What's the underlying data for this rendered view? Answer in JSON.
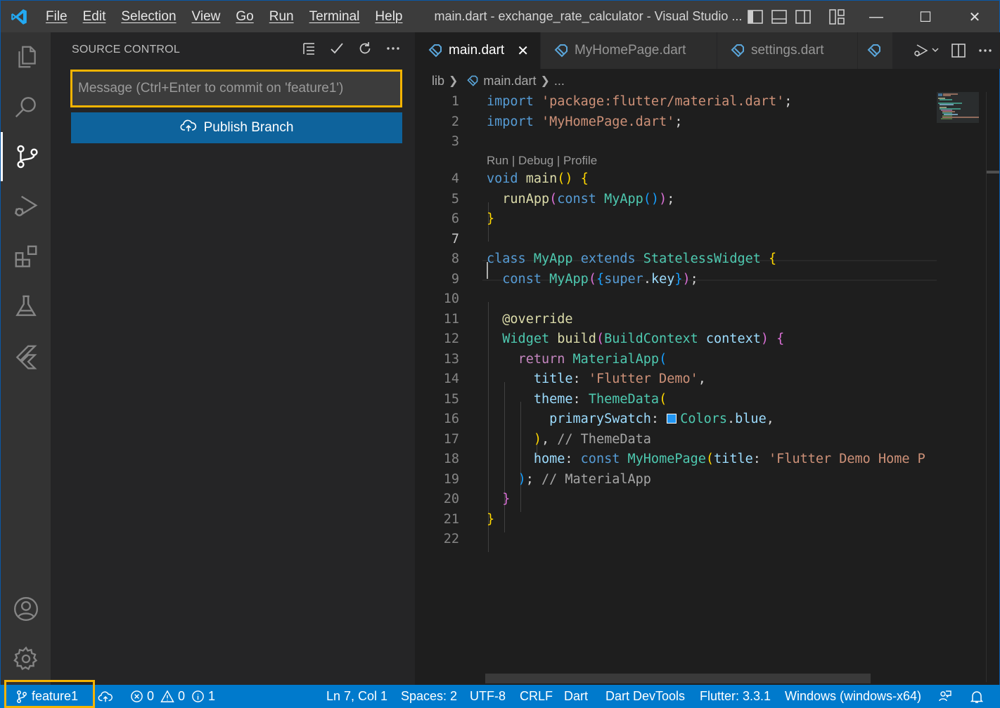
{
  "titlebar": {
    "menu": [
      "File",
      "Edit",
      "Selection",
      "View",
      "Go",
      "Run",
      "Terminal",
      "Help"
    ],
    "window_title": "main.dart - exchange_rate_calculator - Visual Studio ...",
    "controls": {
      "minimize": "—",
      "maximize": "☐",
      "close": "✕"
    }
  },
  "activitybar": {
    "items": [
      "explorer",
      "search",
      "source-control",
      "run-and-debug",
      "extensions",
      "testing",
      "flutter"
    ],
    "bottom": [
      "accounts",
      "manage"
    ],
    "active": "source-control"
  },
  "sidebar": {
    "title": "SOURCE CONTROL",
    "commit_placeholder": "Message (Ctrl+Enter to commit on 'feature1')",
    "publish_label": "Publish Branch"
  },
  "editor": {
    "tabs": [
      {
        "label": "main.dart",
        "active": true
      },
      {
        "label": "MyHomePage.dart",
        "active": false
      },
      {
        "label": "settings.dart",
        "active": false
      }
    ],
    "breadcrumb": {
      "folder": "lib",
      "file": "main.dart",
      "more": "..."
    },
    "codelens": "Run | Debug | Profile",
    "line_numbers": [
      "1",
      "2",
      "3",
      "4",
      "5",
      "6",
      "7",
      "8",
      "9",
      "10",
      "11",
      "12",
      "13",
      "14",
      "15",
      "16",
      "17",
      "18",
      "19",
      "20",
      "21",
      "22"
    ],
    "current_line": "7",
    "code": {
      "l1": [
        "import",
        "'package:flutter/material.dart'",
        ";"
      ],
      "l2": [
        "import",
        "'MyHomePage.dart'",
        ";"
      ],
      "l4": [
        "void",
        "main",
        "()",
        "{"
      ],
      "l5": [
        "runApp",
        "(",
        "const",
        "MyApp",
        "()",
        ")",
        ";"
      ],
      "l6": [
        "}"
      ],
      "l8": [
        "class",
        "MyApp",
        "extends",
        "StatelessWidget",
        "{"
      ],
      "l9": [
        "const",
        "MyApp",
        "(",
        "{",
        "super",
        ".",
        "key",
        "}",
        ")",
        ";"
      ],
      "l11": [
        "@override"
      ],
      "l12": [
        "Widget",
        "build",
        "(",
        "BuildContext",
        "context",
        ")",
        "{"
      ],
      "l13": [
        "return",
        "MaterialApp",
        "("
      ],
      "l14": [
        "title",
        ":",
        "'Flutter Demo'",
        ","
      ],
      "l15": [
        "theme",
        ":",
        "ThemeData",
        "("
      ],
      "l16": [
        "primarySwatch",
        ":",
        "Colors",
        ".",
        "blue",
        ","
      ],
      "l17": [
        ")",
        ",",
        "// ThemeData"
      ],
      "l18": [
        "home",
        ":",
        "const",
        "MyHomePage",
        "(",
        "title",
        ":",
        "'Flutter Demo Home P"
      ],
      "l19": [
        ")",
        ";",
        "// MaterialApp"
      ],
      "l20": [
        "}"
      ],
      "l21": [
        "}"
      ]
    },
    "swatch_color": "#2196f3"
  },
  "statusbar": {
    "branch": "feature1",
    "errors": "0",
    "warnings": "0",
    "infos": "1",
    "position": "Ln 7, Col 1",
    "spaces": "Spaces: 2",
    "encoding": "UTF-8",
    "eol": "CRLF",
    "language": "Dart",
    "devtools": "Dart DevTools",
    "flutter": "Flutter: 3.3.1",
    "device": "Windows (windows-x64)"
  },
  "colors": {
    "accent": "#007acc",
    "highlight_box": "#f5b400",
    "button": "#0e639c"
  }
}
